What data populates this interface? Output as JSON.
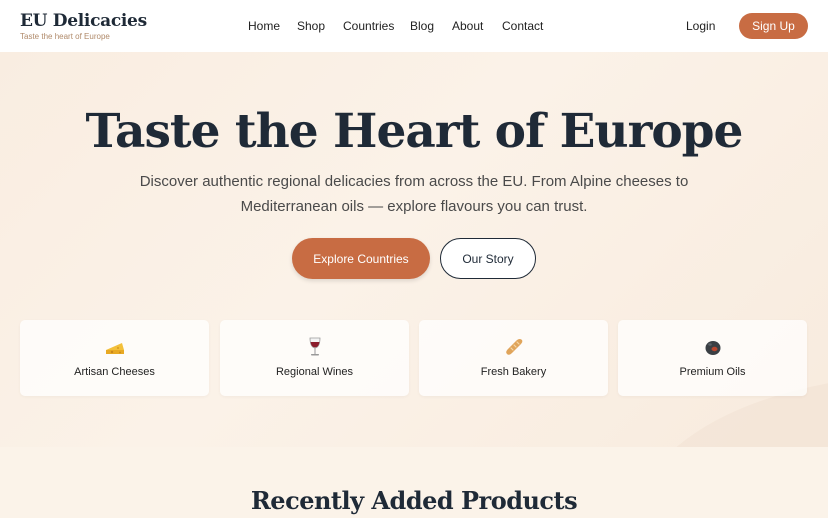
{
  "brand": {
    "title": "EU Delicacies",
    "tagline": "Taste the heart of Europe"
  },
  "nav": {
    "items": [
      "Home",
      "Shop",
      "Countries",
      "Blog",
      "About",
      "Contact"
    ]
  },
  "auth": {
    "login": "Login",
    "signup": "Sign Up"
  },
  "hero": {
    "title": "Taste the Heart of Europe",
    "subtitle": "Discover authentic regional delicacies from across the EU. From Alpine cheeses to Mediterranean oils — explore flavours you can trust.",
    "primary_button": "Explore Countries",
    "secondary_button": "Our Story"
  },
  "categories": [
    {
      "label": "Artisan Cheeses",
      "icon": "cheese-icon"
    },
    {
      "label": "Regional Wines",
      "icon": "wine-glass-icon"
    },
    {
      "label": "Fresh Bakery",
      "icon": "baguette-icon"
    },
    {
      "label": "Premium Oils",
      "icon": "olive-icon"
    }
  ],
  "section": {
    "title": "Recently Added Products"
  },
  "colors": {
    "accent": "#c86c43",
    "dark": "#1f2a37",
    "hero_bg": "#fbf2e8"
  }
}
